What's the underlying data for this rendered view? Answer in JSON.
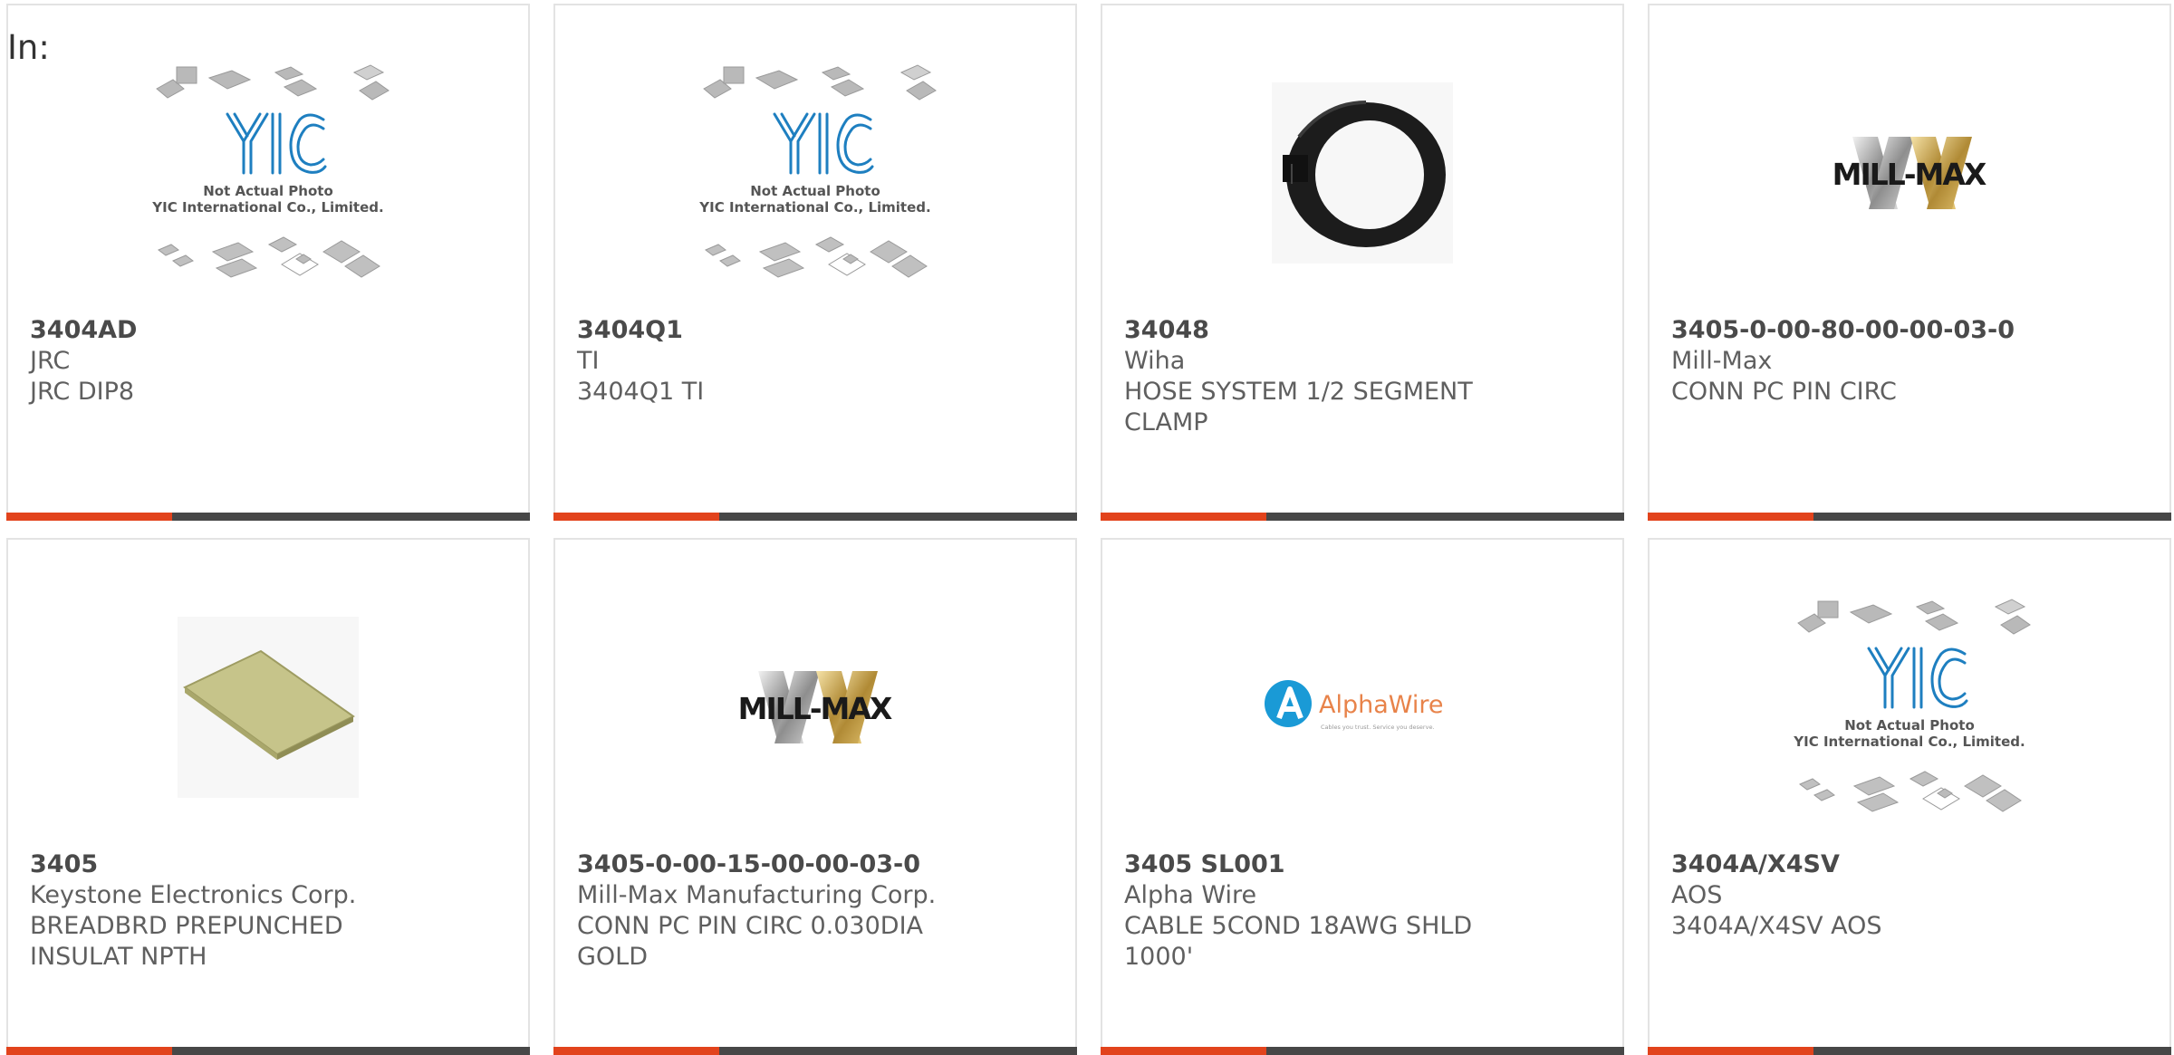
{
  "filter_label": "In:",
  "accent_color": "#e2431c",
  "bar_color": "#474747",
  "products": [
    {
      "part": "3404AD",
      "maker": "JRC",
      "desc": "JRC DIP8",
      "image": "yic-placeholder",
      "image_text": {
        "logo": "YIC",
        "line1": "Not Actual Photo",
        "line2": "YIC International Co., Limited."
      }
    },
    {
      "part": "3404Q1",
      "maker": "TI",
      "desc": "3404Q1 TI",
      "image": "yic-placeholder",
      "image_text": {
        "logo": "YIC",
        "line1": "Not Actual Photo",
        "line2": "YIC International Co., Limited."
      }
    },
    {
      "part": "34048",
      "maker": "Wiha",
      "desc": "HOSE SYSTEM 1/2 SEGMENT CLAMP",
      "image": "hose-clamp"
    },
    {
      "part": "3405-0-00-80-00-00-03-0",
      "maker": "Mill-Max",
      "desc": "CONN PC PIN CIRC",
      "image": "mill-max-logo",
      "image_text": {
        "logo": "MILL-MAX"
      }
    },
    {
      "part": "3405",
      "maker": "Keystone Electronics Corp.",
      "desc": "BREADBRD PREPUNCHED INSULAT NPTH",
      "image": "breadboard"
    },
    {
      "part": "3405-0-00-15-00-00-03-0",
      "maker": "Mill-Max Manufacturing Corp.",
      "desc": "CONN PC PIN CIRC 0.030DIA GOLD",
      "image": "mill-max-logo",
      "image_text": {
        "logo": "MILL-MAX"
      }
    },
    {
      "part": "3405 SL001",
      "maker": "Alpha Wire",
      "desc": "CABLE 5COND 18AWG SHLD 1000'",
      "image": "alphawire-logo",
      "image_text": {
        "logo": "AlphaWire",
        "tagline": "Cables you trust. Service you deserve."
      }
    },
    {
      "part": "3404A/X4SV",
      "maker": "AOS",
      "desc": "3404A/X4SV AOS",
      "image": "yic-placeholder",
      "image_text": {
        "logo": "YIC",
        "line1": "Not Actual Photo",
        "line2": "YIC International Co., Limited."
      }
    }
  ]
}
